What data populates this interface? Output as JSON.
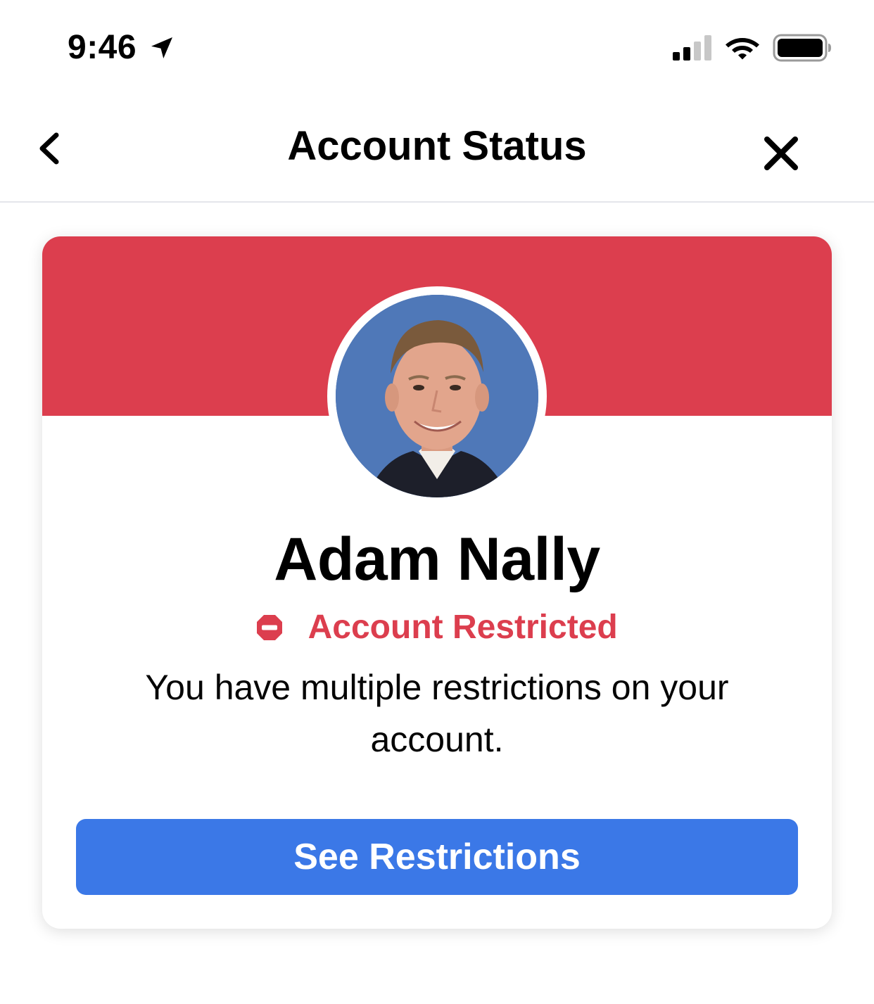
{
  "status_bar": {
    "time": "9:46",
    "icons": [
      "location-arrow-icon",
      "signal-icon",
      "wifi-icon",
      "battery-icon"
    ]
  },
  "nav": {
    "title": "Account Status",
    "back_icon": "chevron-left-icon",
    "close_icon": "close-icon"
  },
  "profile": {
    "name": "Adam Nally",
    "status": "Account Restricted",
    "status_icon": "stop-icon",
    "description": "You have multiple restrictions on your account.",
    "button_label": "See Restrictions"
  },
  "colors": {
    "banner": "#dc3e4e",
    "status_red": "#dc3e4e",
    "button_blue": "#3b78e7",
    "button_text": "#ffffff"
  }
}
